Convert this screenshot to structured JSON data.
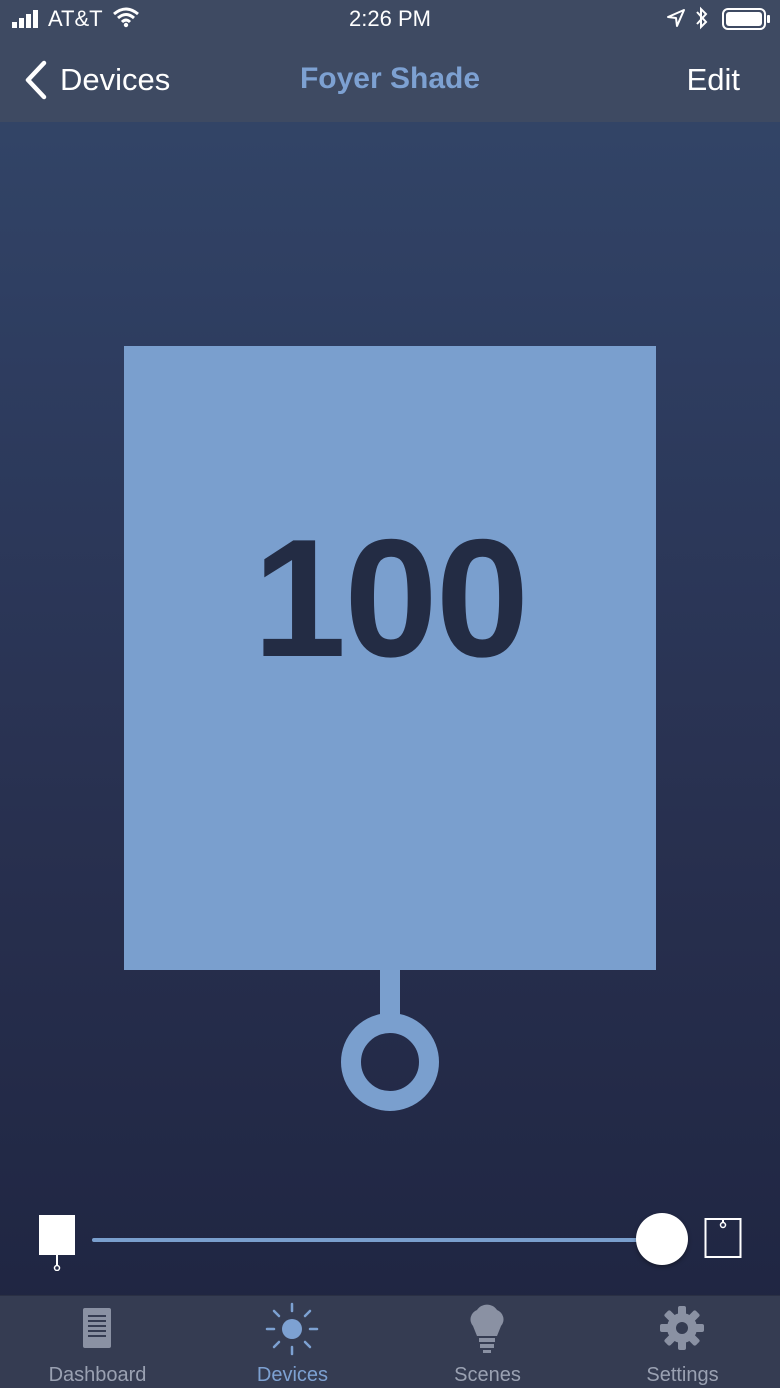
{
  "status_bar": {
    "carrier": "AT&T",
    "time": "2:26 PM"
  },
  "nav": {
    "back_label": "Devices",
    "title": "Foyer Shade",
    "edit_label": "Edit"
  },
  "shade": {
    "value": "100",
    "position_percent": 100
  },
  "tabs": [
    {
      "label": "Dashboard",
      "icon": "dashboard-icon",
      "active": false
    },
    {
      "label": "Devices",
      "icon": "devices-icon",
      "active": true
    },
    {
      "label": "Scenes",
      "icon": "scenes-icon",
      "active": false
    },
    {
      "label": "Settings",
      "icon": "settings-icon",
      "active": false
    }
  ],
  "colors": {
    "accent": "#7da1d2",
    "shade_fill": "#7a9fce",
    "nav_bg": "#3e4a62",
    "tabbar_bg": "#353c52"
  }
}
